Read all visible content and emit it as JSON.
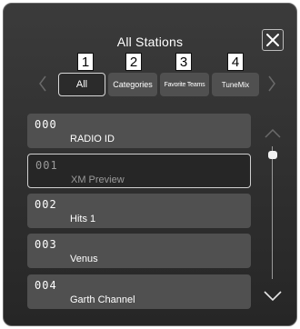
{
  "header": {
    "title": "All Stations"
  },
  "tabs": [
    {
      "label": "All",
      "selected": true
    },
    {
      "label": "Categories",
      "selected": false
    },
    {
      "label": "Favorite Teams",
      "selected": false
    },
    {
      "label": "TuneMix",
      "selected": false
    }
  ],
  "callouts": [
    "1",
    "2",
    "3",
    "4"
  ],
  "stations": [
    {
      "number": "000",
      "name": "RADIO ID",
      "selected": false
    },
    {
      "number": "001",
      "name": "XM Preview",
      "selected": true
    },
    {
      "number": "002",
      "name": "Hits 1",
      "selected": false
    },
    {
      "number": "003",
      "name": "Venus",
      "selected": false
    },
    {
      "number": "004",
      "name": "Garth Channel",
      "selected": false
    }
  ],
  "icons": {
    "close": "close-icon",
    "prev": "chevron-left-icon",
    "next": "chevron-right-icon",
    "scroll_up": "chevron-up-icon",
    "scroll_down": "chevron-down-icon"
  },
  "colors": {
    "background": "#2e2e2e",
    "tab": "#505050",
    "row": "#505050",
    "selected_border": "#cfcfcf",
    "text": "#ffffff",
    "muted_text": "#9a9a9a"
  }
}
